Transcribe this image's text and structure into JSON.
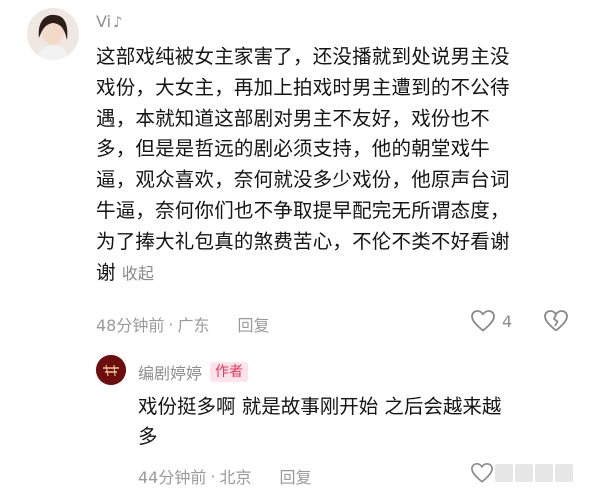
{
  "comment": {
    "username": "Vi",
    "text_lines": [
      "这部戏纯被女主家害了，还没播就到处说男主没",
      "戏份，大女主，再加上拍戏时男主遭到的不公待",
      "遇，本就知道这部剧对男主不友好，戏份也不",
      "多，但是是哲远的剧必须支持，他的朝堂戏牛",
      "逼，观众喜欢，奈何就没多少戏份，他原声台词",
      "牛逼，奈何你们也不争取提早配完无所谓态度，",
      "为了捧大礼包真的煞费苦心，不伦不类不好看谢",
      "谢"
    ],
    "collapse_label": "收起",
    "time": "48分钟前",
    "location": "广东",
    "reply_label": "回复",
    "like_count": "4",
    "like_icon": "heart-icon",
    "dislike_icon": "broken-heart-icon"
  },
  "reply": {
    "username": "编剧婷婷",
    "badge": "作者",
    "text_lines": [
      "戏份挺多啊 就是故事刚开始 之后会越来越",
      "多"
    ],
    "time": "44分钟前",
    "location": "北京",
    "reply_label": "回复"
  },
  "colors": {
    "meta_gray": "#9a9a9a",
    "badge_text": "#e8335a",
    "badge_bg": "#ffe3ea"
  }
}
